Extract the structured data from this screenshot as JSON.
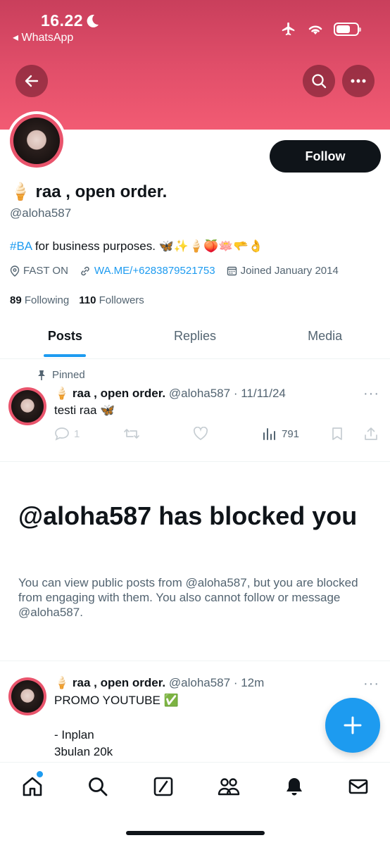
{
  "status_bar": {
    "time": "16.22",
    "back_app": "◂ WhatsApp"
  },
  "profile": {
    "display_name": "🍦 raa , open order.",
    "handle": "@aloha587",
    "follow_label": "Follow",
    "bio_tag": "#BA",
    "bio_text": " for business purposes. 🦋✨🍦🍑🪷🫳👌",
    "location": "FAST ON",
    "link": "WA.ME/+6283879521753",
    "joined": "Joined January 2014",
    "following_count": "89",
    "following_label": "Following",
    "followers_count": "110",
    "followers_label": "Followers"
  },
  "tabs": [
    {
      "label": "Posts",
      "active": true
    },
    {
      "label": "Replies",
      "active": false
    },
    {
      "label": "Media",
      "active": false
    }
  ],
  "pinned_post": {
    "pinned_label": "Pinned",
    "name": "🍦 raa , open order.",
    "meta": " @aloha587 · 11/11/24",
    "text": "testi raa 🦋",
    "replies": "1",
    "views": "791"
  },
  "blocked": {
    "title": "@aloha587 has blocked you",
    "description": "You can view public posts from @aloha587, but you are blocked from engaging with them. You also cannot follow or message @aloha587."
  },
  "recent_post": {
    "name": "🍦 raa , open order.",
    "meta": " @aloha587 · 12m",
    "line1": "PROMO YOUTUBE ✅",
    "line2": "",
    "line3": "- Inplan",
    "line4": "3bulan 20k"
  },
  "colors": {
    "accent": "#1d9bf0",
    "banner": "#e24f6a",
    "text": "#0f1419",
    "muted": "#536471"
  }
}
